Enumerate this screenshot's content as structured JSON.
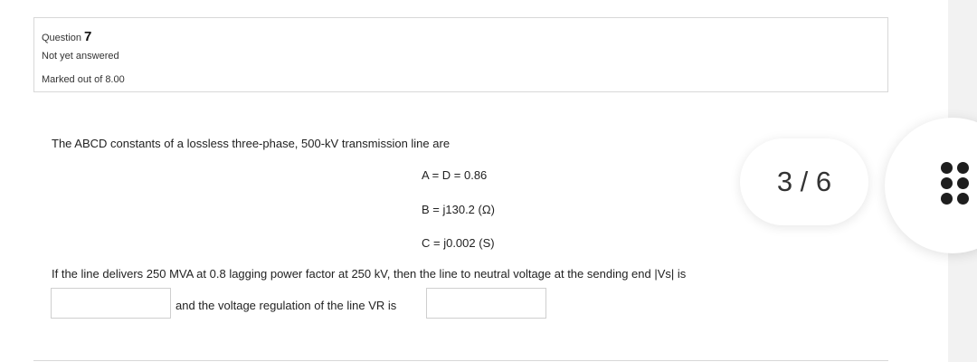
{
  "question": {
    "label": "Question",
    "number": "7",
    "status": "Not yet answered",
    "marks": "Marked out of 8.00"
  },
  "content": {
    "intro": "The ABCD constants of a lossless three-phase, 500-kV transmission line are",
    "equations": [
      "A = D = 0.86",
      "B = j130.2 (Ω)",
      "C = j0.002 (S)"
    ],
    "delivery": "If the line delivers 250 MVA at 0.8 lagging power factor at 250 kV, then the line to neutral voltage at the sending end |Vs| is",
    "vr_text": "and the voltage regulation of the line VR is"
  },
  "inputs": {
    "vs_value": "",
    "vr_value": ""
  },
  "page_counter": "3 / 6",
  "icons": {
    "menu": "more-dots-icon"
  }
}
